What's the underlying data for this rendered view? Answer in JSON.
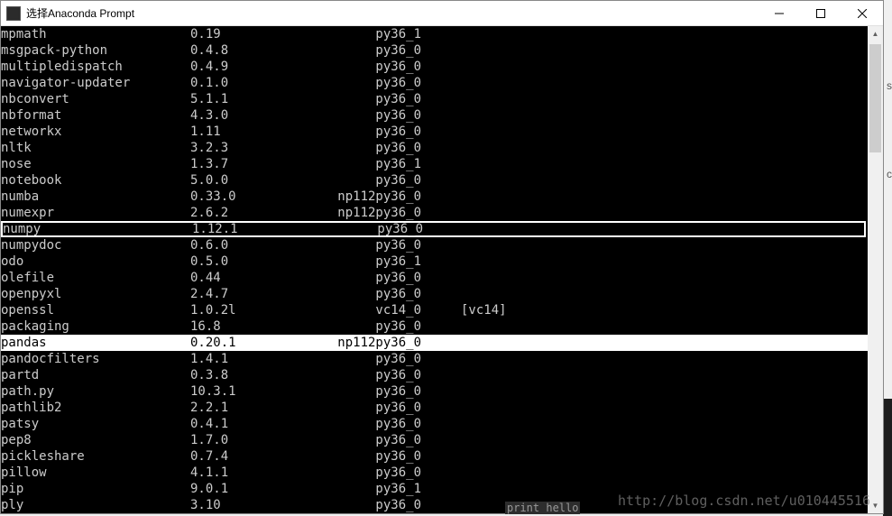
{
  "window": {
    "title": "选择Anaconda Prompt"
  },
  "packages": [
    {
      "name": "mpmath",
      "version": "0.19",
      "build": "py36_1",
      "extra": ""
    },
    {
      "name": "msgpack-python",
      "version": "0.4.8",
      "build": "py36_0",
      "extra": ""
    },
    {
      "name": "multipledispatch",
      "version": "0.4.9",
      "build": "py36_0",
      "extra": ""
    },
    {
      "name": "navigator-updater",
      "version": "0.1.0",
      "build": "py36_0",
      "extra": ""
    },
    {
      "name": "nbconvert",
      "version": "5.1.1",
      "build": "py36_0",
      "extra": ""
    },
    {
      "name": "nbformat",
      "version": "4.3.0",
      "build": "py36_0",
      "extra": ""
    },
    {
      "name": "networkx",
      "version": "1.11",
      "build": "py36_0",
      "extra": ""
    },
    {
      "name": "nltk",
      "version": "3.2.3",
      "build": "py36_0",
      "extra": ""
    },
    {
      "name": "nose",
      "version": "1.3.7",
      "build": "py36_1",
      "extra": ""
    },
    {
      "name": "notebook",
      "version": "5.0.0",
      "build": "py36_0",
      "extra": ""
    },
    {
      "name": "numba",
      "version": "0.33.0",
      "build": "np112py36_0",
      "extra": ""
    },
    {
      "name": "numexpr",
      "version": "2.6.2",
      "build": "np112py36_0",
      "extra": ""
    },
    {
      "name": "numpy",
      "version": "1.12.1",
      "build": "py36_0",
      "extra": "",
      "boxed": true
    },
    {
      "name": "numpydoc",
      "version": "0.6.0",
      "build": "py36_0",
      "extra": ""
    },
    {
      "name": "odo",
      "version": "0.5.0",
      "build": "py36_1",
      "extra": ""
    },
    {
      "name": "olefile",
      "version": "0.44",
      "build": "py36_0",
      "extra": ""
    },
    {
      "name": "openpyxl",
      "version": "2.4.7",
      "build": "py36_0",
      "extra": ""
    },
    {
      "name": "openssl",
      "version": "1.0.2l",
      "build": "vc14_0",
      "extra": "[vc14]"
    },
    {
      "name": "packaging",
      "version": "16.8",
      "build": "py36_0",
      "extra": ""
    },
    {
      "name": "pandas",
      "version": "0.20.1",
      "build": "np112py36_0",
      "extra": "",
      "highlighted": true
    },
    {
      "name": "pandocfilters",
      "version": "1.4.1",
      "build": "py36_0",
      "extra": ""
    },
    {
      "name": "partd",
      "version": "0.3.8",
      "build": "py36_0",
      "extra": ""
    },
    {
      "name": "path.py",
      "version": "10.3.1",
      "build": "py36_0",
      "extra": ""
    },
    {
      "name": "pathlib2",
      "version": "2.2.1",
      "build": "py36_0",
      "extra": ""
    },
    {
      "name": "patsy",
      "version": "0.4.1",
      "build": "py36_0",
      "extra": ""
    },
    {
      "name": "pep8",
      "version": "1.7.0",
      "build": "py36_0",
      "extra": ""
    },
    {
      "name": "pickleshare",
      "version": "0.7.4",
      "build": "py36_0",
      "extra": ""
    },
    {
      "name": "pillow",
      "version": "4.1.1",
      "build": "py36_0",
      "extra": ""
    },
    {
      "name": "pip",
      "version": "9.0.1",
      "build": "py36_1",
      "extra": ""
    },
    {
      "name": "ply",
      "version": "3.10",
      "build": "py36_0",
      "extra": ""
    }
  ],
  "watermark": "http://blog.csdn.net/u010445516",
  "bg_fragments": {
    "s": "s",
    "c": "c",
    "bottom_text": "print hello"
  }
}
